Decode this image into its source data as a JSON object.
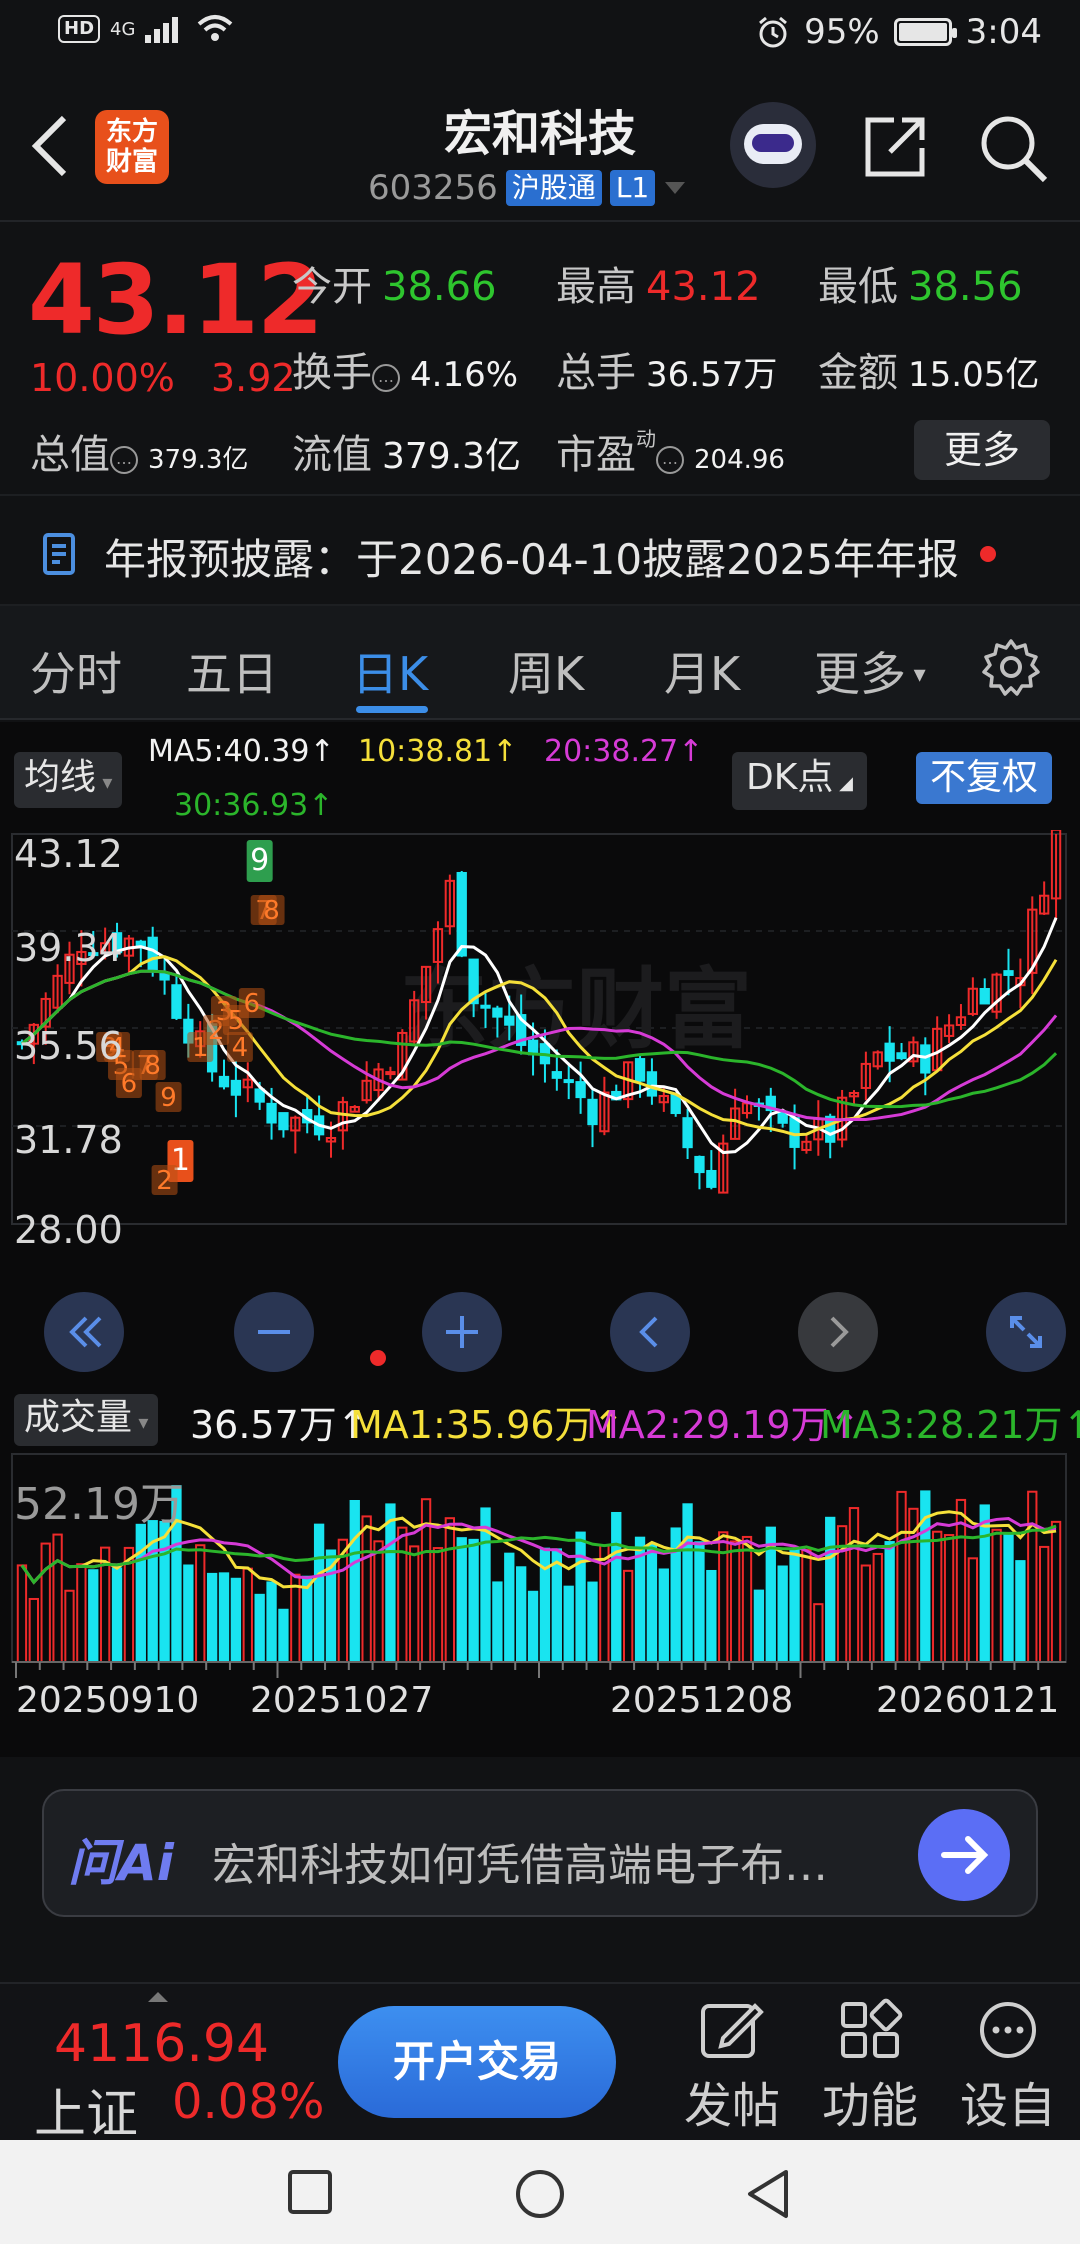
{
  "status_bar": {
    "network": "4G",
    "hd": "HD",
    "battery": "95%",
    "time": "3:04"
  },
  "header": {
    "logo_line1": "东方",
    "logo_line2": "财富",
    "title": "宏和科技",
    "code": "603256",
    "tag1": "沪股通",
    "tag2": "L1"
  },
  "quote": {
    "price": "43.12",
    "change_pct": "10.00%",
    "change_amt": "3.92",
    "open_label": "今开",
    "open": "38.66",
    "high_label": "最高",
    "high": "43.12",
    "low_label": "最低",
    "low": "38.56",
    "turnover_label": "换手",
    "turnover": "4.16%",
    "volume_label": "总手",
    "volume": "36.57万",
    "amount_label": "金额",
    "amount": "15.05亿",
    "mktcap_label": "总值",
    "mktcap": "379.3亿",
    "float_label": "流值",
    "float": "379.3亿",
    "pe_label": "市盈",
    "pe_sup": "动",
    "pe": "204.96",
    "more": "更多"
  },
  "notice": {
    "text": "年报预披露：于2026-04-10披露2025年年报"
  },
  "tabs": [
    "分时",
    "五日",
    "日K",
    "周K",
    "月K",
    "更多"
  ],
  "active_tab": "日K",
  "chart": {
    "indicator_select": "均线",
    "ma5": "MA5:40.39↑",
    "ma10": "10:38.81↑",
    "ma20": "20:38.27↑",
    "ma30": "30:36.93↑",
    "dk": "DK点",
    "adjust": "不复权",
    "y_labels": [
      "43.12",
      "39.34",
      "35.56",
      "31.78",
      "28.00"
    ],
    "vol_select": "成交量",
    "vol_value": "36.57万↑",
    "vol_ma1": "MA1:35.96万↑",
    "vol_ma2": "MA2:29.19万↑",
    "vol_ma3": "MA3:28.21万↑",
    "vol_max": "52.19万",
    "x_labels": [
      "20250910",
      "20251027",
      "20251208",
      "20260121"
    ],
    "markers": [
      "9",
      "7",
      "8",
      "1",
      "2",
      "3",
      "4",
      "5",
      "6",
      "7",
      "8",
      "9",
      "1",
      "2",
      "3",
      "4",
      "5",
      "6"
    ],
    "watermark": "东方财富"
  },
  "ai": {
    "logo": "问Ai",
    "prompt": "宏和科技如何凭借高端电子布…"
  },
  "bottom": {
    "index_value": "4116.94",
    "index_name": "上证",
    "index_change": "0.08%",
    "trade": "开户交易",
    "post": "发帖",
    "func": "功能",
    "custom": "设自"
  },
  "colors": {
    "up": "#ee2a2a",
    "down": "#19e4f0",
    "ma5": "#ffffff",
    "ma10": "#f5e03a",
    "ma20": "#d63bd6",
    "ma30": "#2bb52b",
    "accent": "#3c8ee8"
  }
}
